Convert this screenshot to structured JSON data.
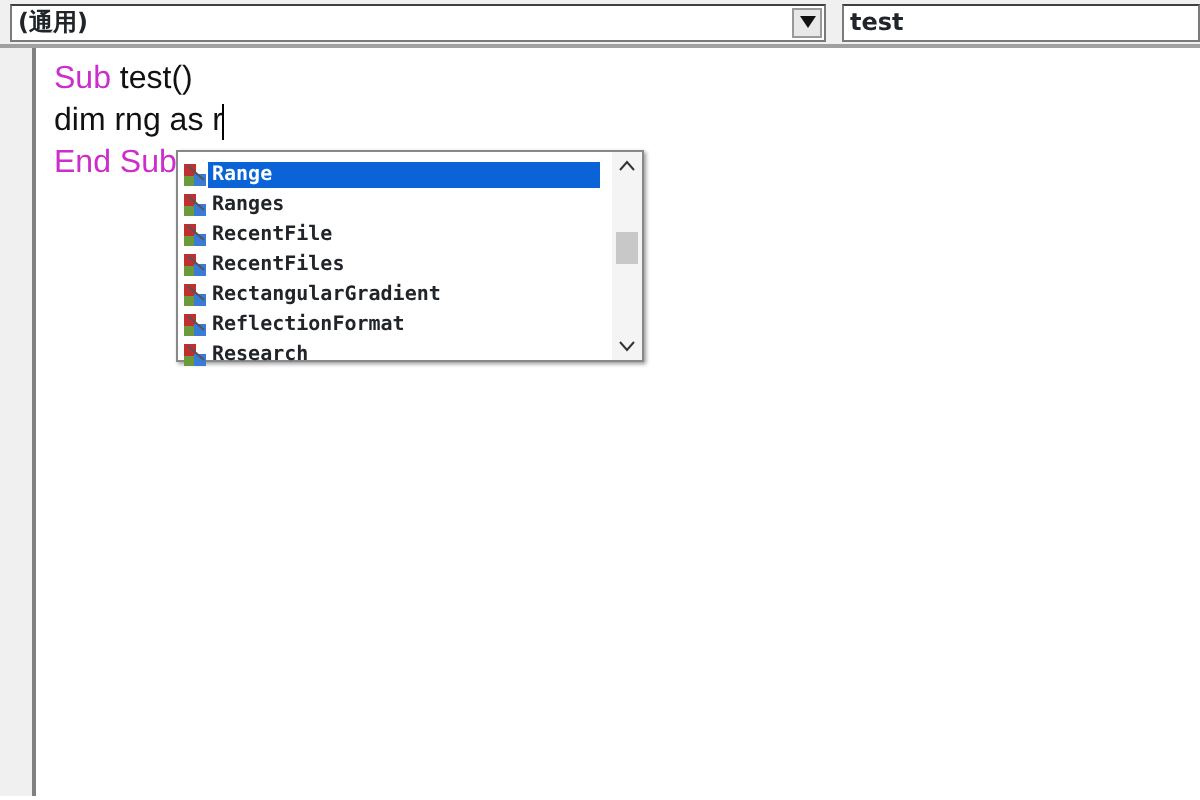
{
  "toolbar": {
    "object_combo": "(通用)",
    "procedure_combo": "test"
  },
  "code_lines": [
    {
      "tokens": [
        {
          "text": "Sub",
          "kind": "keyword"
        },
        {
          "text": "test()",
          "kind": "plain"
        }
      ],
      "cursor": false
    },
    {
      "tokens": [
        {
          "text": "dim rng as r",
          "kind": "plain"
        }
      ],
      "cursor": true
    },
    {
      "tokens": [
        {
          "text": "End Sub",
          "kind": "keyword"
        }
      ],
      "cursor": false
    }
  ],
  "autocomplete": {
    "items": [
      {
        "label": "Range",
        "selected": true
      },
      {
        "label": "Ranges",
        "selected": false
      },
      {
        "label": "RecentFile",
        "selected": false
      },
      {
        "label": "RecentFiles",
        "selected": false
      },
      {
        "label": "RectangularGradient",
        "selected": false
      },
      {
        "label": "ReflectionFormat",
        "selected": false
      },
      {
        "label": "Research",
        "selected": false
      }
    ]
  }
}
